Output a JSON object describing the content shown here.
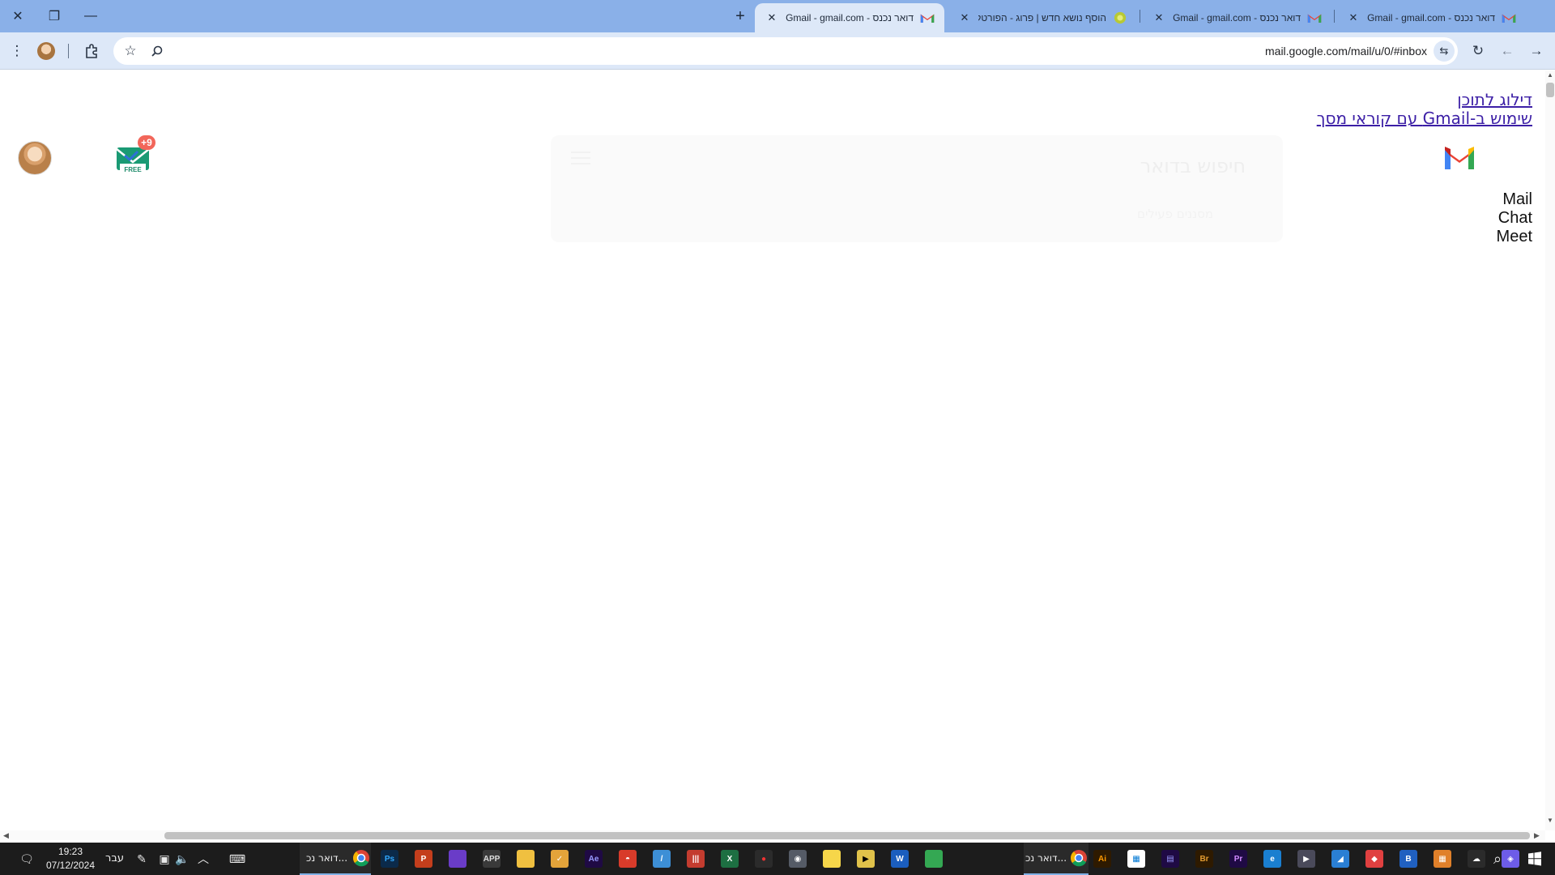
{
  "tabs": [
    {
      "title": "דואר נכנס - Gmail - gmail.com@",
      "active": true
    },
    {
      "title": "הוסף נושא חדש | פרוג - הפורטל",
      "active": false
    },
    {
      "title": "דואר נכנס - Gmail - gmail.com@",
      "active": false
    },
    {
      "title": "דואר נכנס - Gmail - gmail.com@",
      "active": false
    }
  ],
  "toolbar": {
    "url": "mail.google.com/mail/u/0/#inbox"
  },
  "page": {
    "skip_link": "דילוג לתוכן",
    "screen_reader_link": "שימוש ב-Gmail עם קוראי מסך",
    "side_items": [
      "Mail",
      "Chat",
      "Meet"
    ],
    "ghost_title": "חיפוש בדואר",
    "ghost_subtitle": "מסננים פעילים",
    "extension_badge_count": "+9",
    "extension_free_label": "FREE"
  },
  "taskbar": {
    "time": "19:23",
    "date": "07/12/2024",
    "language": "עבר",
    "task_left_label": "דואר נכ...",
    "task_right_label": "דואר נכ...",
    "apps": [
      {
        "name": "photoshop",
        "label": "Ps",
        "color": "#0b2a4a",
        "text_color": "#31a8ff"
      },
      {
        "name": "powerpoint",
        "label": "P",
        "color": "#c43e1c",
        "text_color": "#ffffff"
      },
      {
        "name": "drop-app",
        "label": "",
        "color": "#6a3cc8",
        "text_color": "#ffffff"
      },
      {
        "name": "app-tool",
        "label": "APP",
        "color": "#3a3a3a",
        "text_color": "#dddddd"
      },
      {
        "name": "file-explorer",
        "label": "",
        "color": "#f0c040",
        "text_color": "#000000"
      },
      {
        "name": "task-app",
        "label": "✓",
        "color": "#e3a33a",
        "text_color": "#ffffff"
      },
      {
        "name": "after-effects",
        "label": "Ae",
        "color": "#1f0a44",
        "text_color": "#9a9aff"
      },
      {
        "name": "pdf-app",
        "label": "◓",
        "color": "#d83b2a",
        "text_color": "#ffffff"
      },
      {
        "name": "draw-app",
        "label": "/",
        "color": "#3d8fd6",
        "text_color": "#ffffff"
      },
      {
        "name": "bars-app",
        "label": "|||",
        "color": "#c33c2f",
        "text_color": "#ffffff"
      },
      {
        "name": "excel",
        "label": "X",
        "color": "#1d6f42",
        "text_color": "#ffffff"
      },
      {
        "name": "recorder",
        "label": "●",
        "color": "#2b2b2b",
        "text_color": "#e33"
      },
      {
        "name": "capture-app",
        "label": "◉",
        "color": "#555b66",
        "text_color": "#ffffff"
      },
      {
        "name": "sticky-notes",
        "label": "",
        "color": "#f6d64a",
        "text_color": "#000000"
      },
      {
        "name": "media-player",
        "label": "▶",
        "color": "#e0c24a",
        "text_color": "#000000"
      },
      {
        "name": "word",
        "label": "W",
        "color": "#1b5ebe",
        "text_color": "#ffffff"
      },
      {
        "name": "chrome",
        "label": "",
        "color": "#34a853",
        "text_color": "#ffffff"
      },
      {
        "name": "illustrator",
        "label": "Ai",
        "color": "#2e1a00",
        "text_color": "#ff9a00"
      },
      {
        "name": "store",
        "label": "▦",
        "color": "#ffffff",
        "text_color": "#0078d4"
      },
      {
        "name": "premiere-pro-alt",
        "label": "▤",
        "color": "#1f0a44",
        "text_color": "#9a9aff"
      },
      {
        "name": "bridge",
        "label": "Br",
        "color": "#2e1a00",
        "text_color": "#e09a30"
      },
      {
        "name": "premiere-pro",
        "label": "Pr",
        "color": "#1f0a44",
        "text_color": "#d08aff"
      },
      {
        "name": "edge",
        "label": "e",
        "color": "#1a7fd0",
        "text_color": "#ffffff"
      },
      {
        "name": "play-app",
        "label": "▶",
        "color": "#4a4a5a",
        "text_color": "#ffffff"
      },
      {
        "name": "photos",
        "label": "◢",
        "color": "#2a7fd4",
        "text_color": "#ffffff"
      },
      {
        "name": "multicolor-app",
        "label": "◆",
        "color": "#e04040",
        "text_color": "#ffffff"
      },
      {
        "name": "b-app",
        "label": "B",
        "color": "#2060c0",
        "text_color": "#ffffff"
      },
      {
        "name": "calculator-app",
        "label": "▦",
        "color": "#e0802a",
        "text_color": "#ffffff"
      },
      {
        "name": "weather-app",
        "label": "☁",
        "color": "#2b2b2b",
        "text_color": "#ffffff"
      },
      {
        "name": "copilot",
        "label": "◈",
        "color": "#6d5ce8",
        "text_color": "#ffffff"
      }
    ]
  }
}
